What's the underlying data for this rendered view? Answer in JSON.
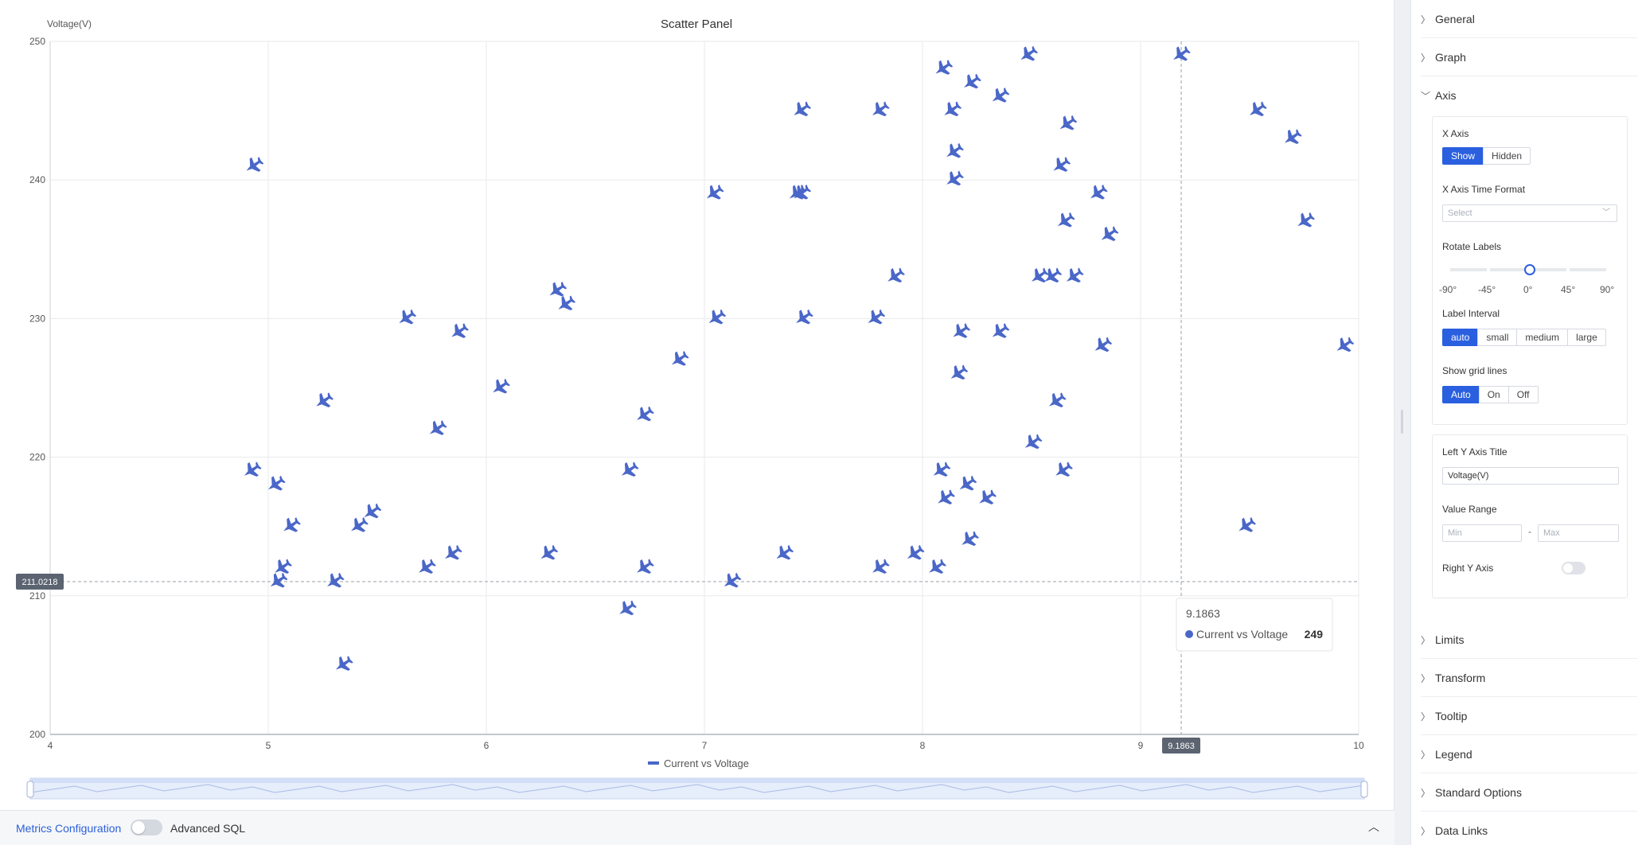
{
  "chart": {
    "title": "Scatter Panel",
    "y_axis_title": "Voltage(V)",
    "legend_label": "Current vs Voltage",
    "crosshair": {
      "x_label": "9.1863",
      "y_label": "211.0218"
    },
    "tooltip": {
      "title": "9.1863",
      "series": "Current vs Voltage",
      "value": "249"
    }
  },
  "chart_data": {
    "type": "scatter",
    "title": "Scatter Panel",
    "xlabel": "",
    "ylabel": "Voltage(V)",
    "xlim": [
      4,
      10
    ],
    "ylim": [
      200,
      250
    ],
    "x_ticks": [
      "4",
      "5",
      "6",
      "7",
      "8",
      "9",
      "10"
    ],
    "y_ticks": [
      "200",
      "210",
      "220",
      "230",
      "240",
      "250"
    ],
    "grid": true,
    "legend_position": "bottom-center",
    "marker": "airplane",
    "series_color": "#4a67c8",
    "series": [
      {
        "name": "Current vs Voltage",
        "points": [
          [
            4.93,
            241
          ],
          [
            4.92,
            219
          ],
          [
            5.03,
            218
          ],
          [
            5.1,
            215
          ],
          [
            5.06,
            212
          ],
          [
            5.04,
            211
          ],
          [
            5.25,
            224
          ],
          [
            5.3,
            211
          ],
          [
            5.34,
            205
          ],
          [
            5.41,
            215
          ],
          [
            5.47,
            216
          ],
          [
            5.63,
            230
          ],
          [
            5.72,
            212
          ],
          [
            5.77,
            222
          ],
          [
            5.84,
            213
          ],
          [
            5.87,
            229
          ],
          [
            6.06,
            225
          ],
          [
            6.28,
            213
          ],
          [
            6.32,
            232
          ],
          [
            6.36,
            231
          ],
          [
            6.65,
            219
          ],
          [
            6.64,
            209
          ],
          [
            6.72,
            223
          ],
          [
            6.72,
            212
          ],
          [
            6.88,
            227
          ],
          [
            7.04,
            239
          ],
          [
            7.05,
            230
          ],
          [
            7.12,
            211
          ],
          [
            7.36,
            213
          ],
          [
            7.42,
            239
          ],
          [
            7.44,
            239
          ],
          [
            7.44,
            245
          ],
          [
            7.45,
            230
          ],
          [
            7.78,
            230
          ],
          [
            7.8,
            245
          ],
          [
            7.8,
            212
          ],
          [
            7.87,
            233
          ],
          [
            7.96,
            213
          ],
          [
            8.06,
            212
          ],
          [
            8.08,
            219
          ],
          [
            8.09,
            248
          ],
          [
            8.1,
            217
          ],
          [
            8.13,
            245
          ],
          [
            8.14,
            242
          ],
          [
            8.14,
            240
          ],
          [
            8.16,
            226
          ],
          [
            8.17,
            229
          ],
          [
            8.2,
            218
          ],
          [
            8.21,
            214
          ],
          [
            8.22,
            247
          ],
          [
            8.29,
            217
          ],
          [
            8.35,
            246
          ],
          [
            8.35,
            229
          ],
          [
            8.48,
            249
          ],
          [
            8.5,
            221
          ],
          [
            8.53,
            233
          ],
          [
            8.59,
            233
          ],
          [
            8.61,
            224
          ],
          [
            8.63,
            241
          ],
          [
            8.64,
            219
          ],
          [
            8.65,
            237
          ],
          [
            8.66,
            244
          ],
          [
            8.69,
            233
          ],
          [
            8.8,
            239
          ],
          [
            8.82,
            228
          ],
          [
            8.85,
            236
          ],
          [
            9.18,
            249
          ],
          [
            9.48,
            215
          ],
          [
            9.53,
            245
          ],
          [
            9.69,
            243
          ],
          [
            9.75,
            237
          ],
          [
            9.93,
            228
          ]
        ]
      }
    ]
  },
  "bottom_bar": {
    "metrics_label": "Metrics Configuration",
    "advanced_label": "Advanced SQL"
  },
  "side_panel": {
    "sections": {
      "general": "General",
      "graph": "Graph",
      "axis": "Axis",
      "limits": "Limits",
      "transform": "Transform",
      "tooltip": "Tooltip",
      "legend": "Legend",
      "standard_options": "Standard Options",
      "data_links": "Data Links"
    },
    "axis": {
      "x_axis_label": "X Axis",
      "x_axis_options": [
        "Show",
        "Hidden"
      ],
      "x_axis_selected": "Show",
      "time_format_label": "X Axis Time Format",
      "time_format_placeholder": "Select",
      "rotate_label": "Rotate Labels",
      "rotate_ticks": [
        "-90°",
        "-45°",
        "0°",
        "45°",
        "90°"
      ],
      "rotate_value": "0°",
      "interval_label": "Label Interval",
      "interval_options": [
        "auto",
        "small",
        "medium",
        "large"
      ],
      "interval_selected": "auto",
      "grid_label": "Show grid lines",
      "grid_options": [
        "Auto",
        "On",
        "Off"
      ],
      "grid_selected": "Auto",
      "left_y_title_label": "Left Y Axis Title",
      "left_y_title_value": "Voltage(V)",
      "value_range_label": "Value Range",
      "min_placeholder": "Min",
      "range_sep": "-",
      "max_placeholder": "Max",
      "right_y_label": "Right Y Axis",
      "right_y_enabled": false
    }
  }
}
